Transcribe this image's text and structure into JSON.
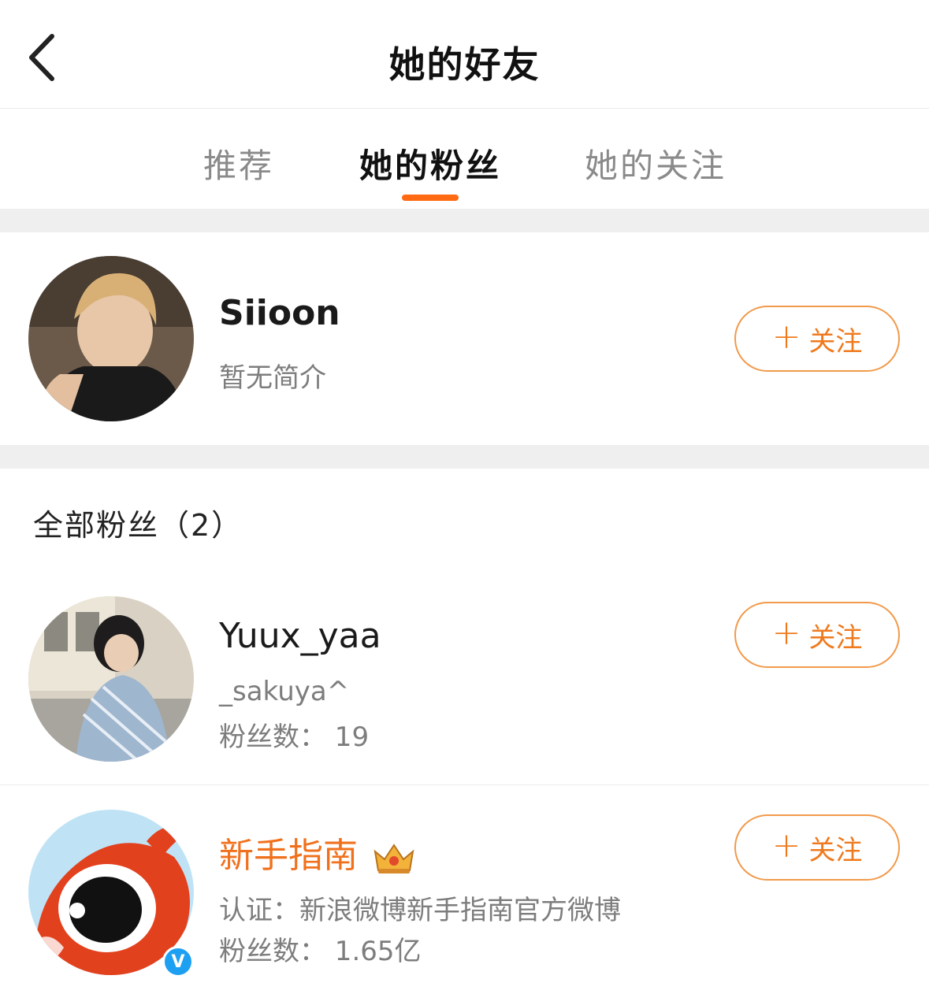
{
  "header": {
    "title": "她的好友",
    "back_icon": "chevron-left-icon"
  },
  "tabs": [
    {
      "label": "推荐",
      "active": false
    },
    {
      "label": "她的粉丝",
      "active": true
    },
    {
      "label": "她的关注",
      "active": false
    }
  ],
  "accent_color": "#ff6a13",
  "featured_user": {
    "name": "Siioon",
    "bio": "暂无简介",
    "follow_label": "关注"
  },
  "section": {
    "title": "全部粉丝（2）"
  },
  "fans": [
    {
      "name": "Yuux_yaa",
      "line1": "_sakuya^",
      "line2": "粉丝数： 19",
      "follow_label": "关注"
    },
    {
      "name": "新手指南",
      "name_color": "#f0711d",
      "line1": "认证：新浪微博新手指南官方微博",
      "line2": "粉丝数： 1.65亿",
      "follow_label": "关注",
      "badge_icon": "crown-icon",
      "verified_mark": "V"
    }
  ]
}
